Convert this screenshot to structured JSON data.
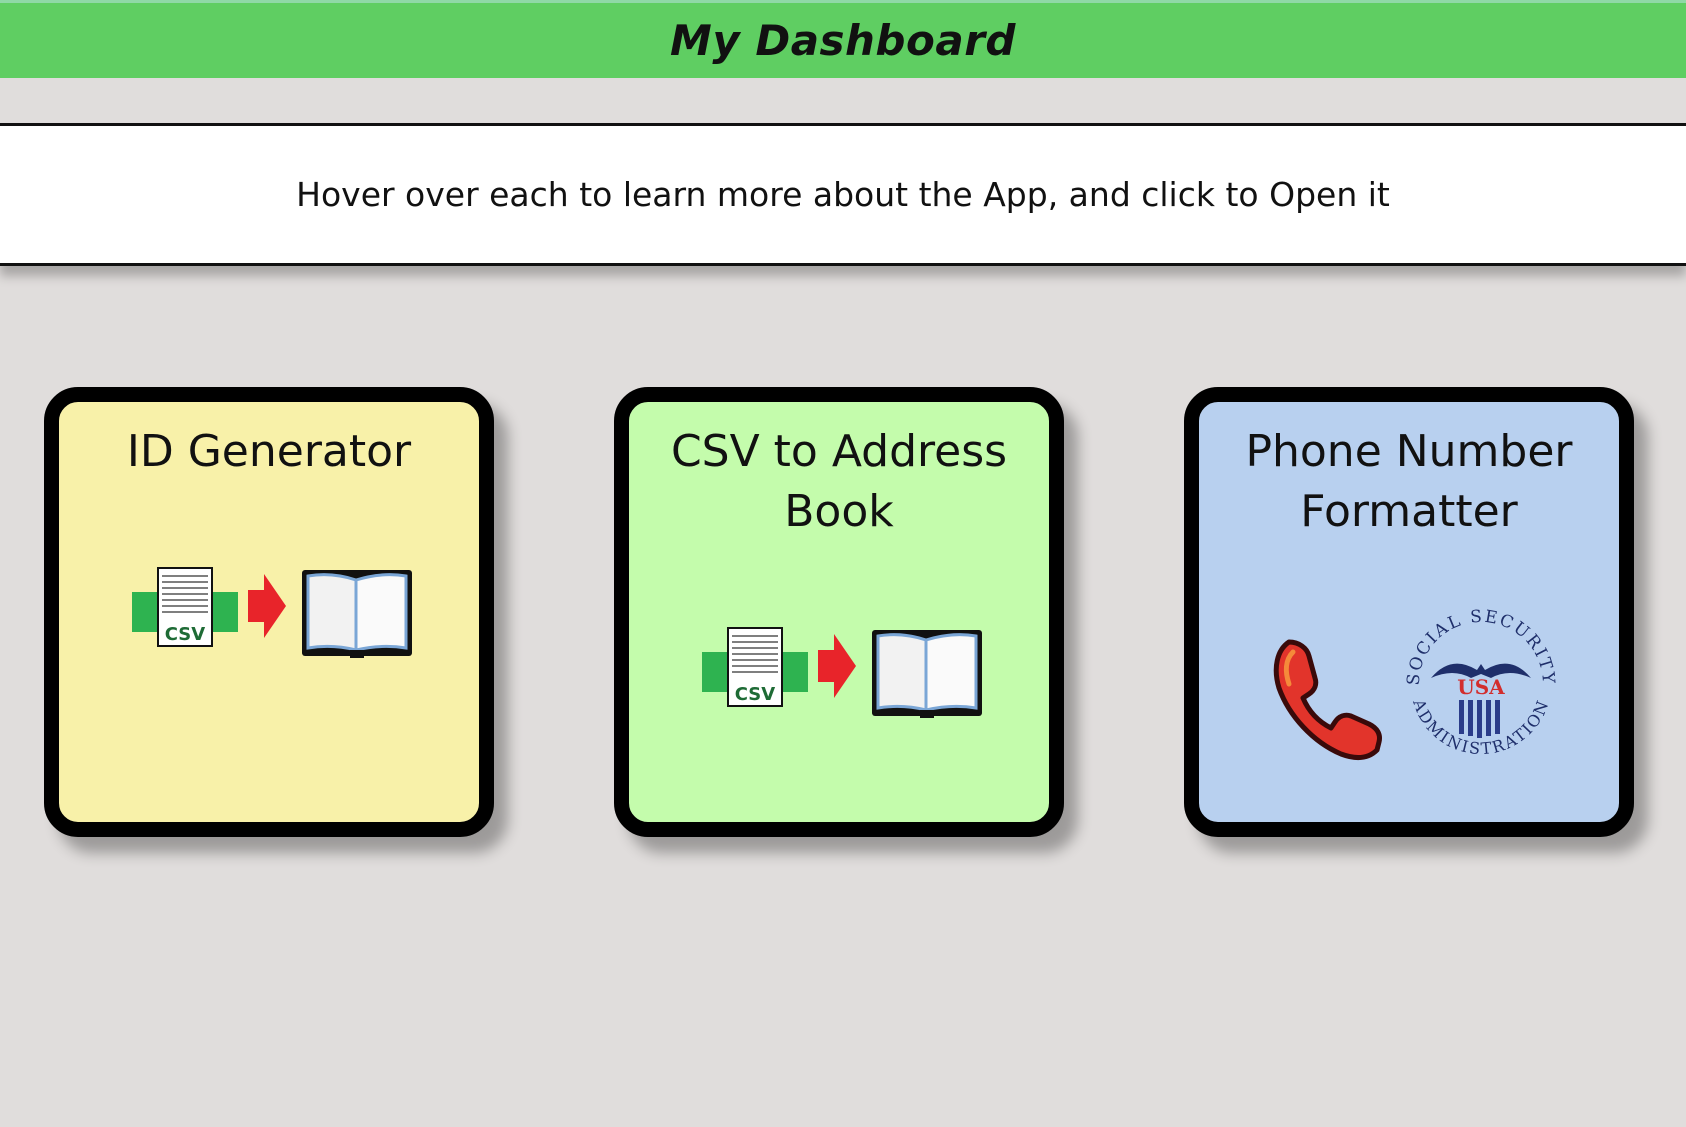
{
  "header": {
    "title": "My Dashboard"
  },
  "info": {
    "text": "Hover over each to learn more about the App, and click to Open it"
  },
  "cards": [
    {
      "title": "ID Generator",
      "color": "#f8f1a9",
      "icons": [
        "csv-file-icon",
        "red-arrow-icon",
        "open-book-icon"
      ],
      "csv_label": "CSV"
    },
    {
      "title": "CSV to Address Book",
      "color": "#c4fcac",
      "icons": [
        "csv-file-icon",
        "red-arrow-icon",
        "open-book-icon"
      ],
      "csv_label": "CSV"
    },
    {
      "title": "Phone Number Formatter",
      "color": "#b8d0ef",
      "icons": [
        "phone-icon",
        "social-security-seal-icon"
      ],
      "seal_top_text": "SOCIAL SECURITY",
      "seal_bottom_text": "ADMINISTRATION",
      "seal_center_text": "USA"
    }
  ],
  "colors": {
    "header_bg": "#5fce62",
    "page_bg": "#e0dddc"
  }
}
